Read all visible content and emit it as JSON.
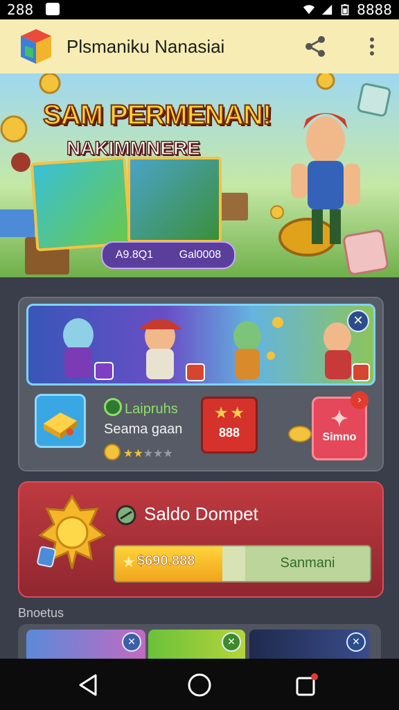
{
  "status_bar": {
    "time": "288",
    "right_text": "8888"
  },
  "app_bar": {
    "title": "Plsmaniku Nanasiai",
    "icons": [
      "app-logo-icon",
      "share-icon",
      "more-vert-icon"
    ]
  },
  "hero": {
    "title_line1": "SAM PERMENAN!",
    "title_line2": "NAKIMMNERE",
    "pill_left": "A9.8Q1",
    "pill_right": "Gal0008"
  },
  "game_card": {
    "title": "Laipruhs",
    "subtitle": "Seama gaan",
    "rating_value": 2,
    "rating_max": 5,
    "badge_value": "888",
    "action_label": "Simno"
  },
  "wallet": {
    "title": "Saldo Dompet",
    "amount": "$690.888",
    "button_label": "Sanmani",
    "fill_fraction": 0.42
  },
  "section": {
    "label": "Bnoetus"
  },
  "nav": {
    "icons": [
      "back-icon",
      "home-icon",
      "recents-icon"
    ]
  },
  "colors": {
    "appbar": "#f7edb4",
    "accent_red": "#bf3a40",
    "gold": "#ffd33a"
  }
}
